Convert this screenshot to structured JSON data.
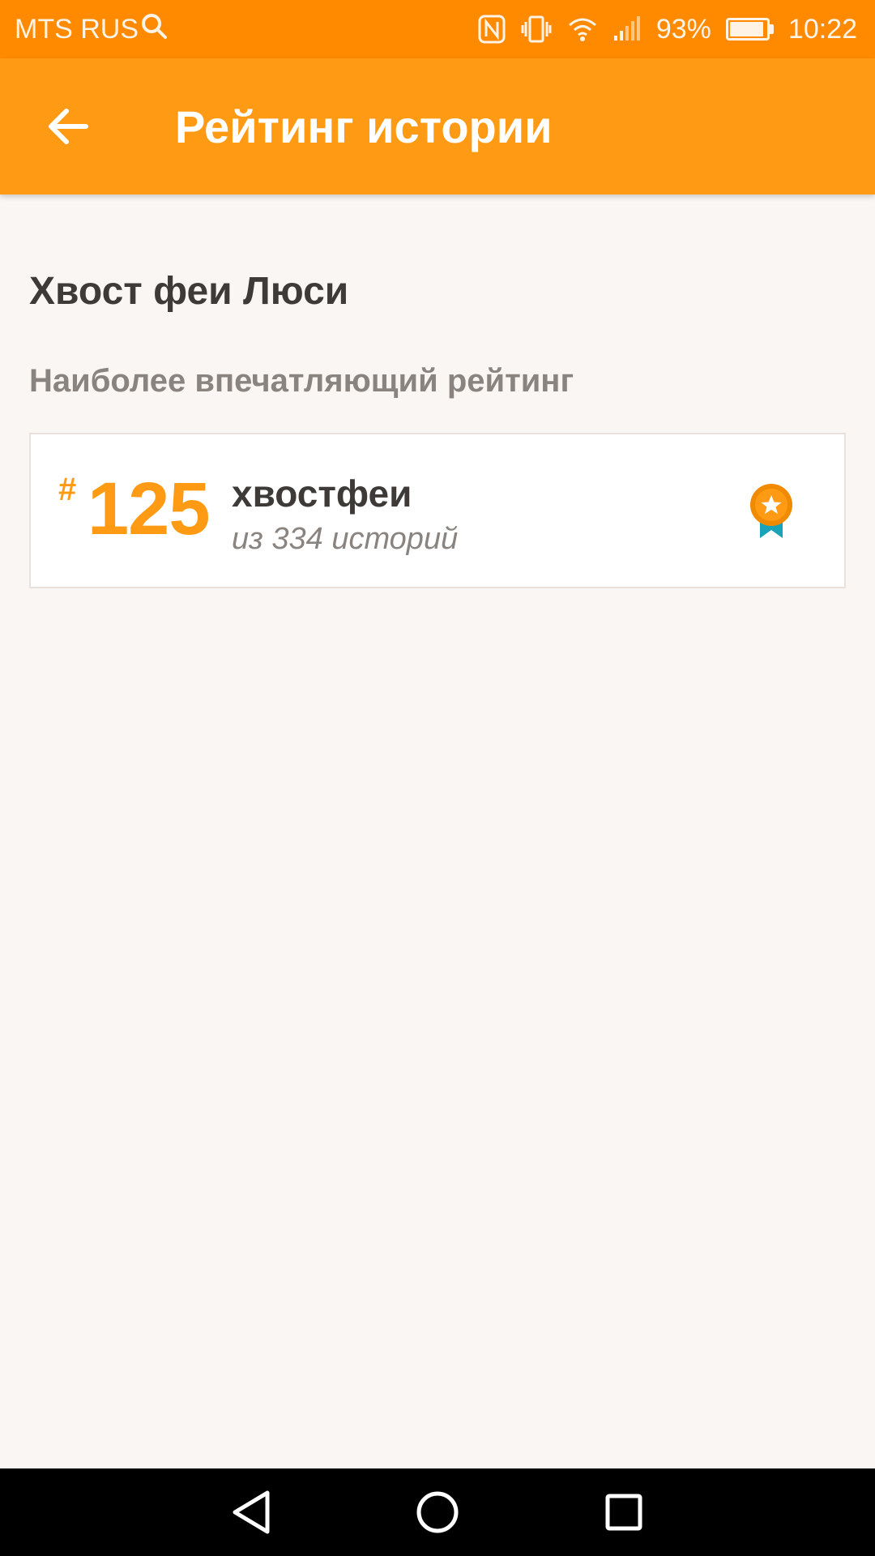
{
  "status_bar": {
    "carrier": "MTS RUS",
    "battery_percent": "93%",
    "battery_level": 0.93,
    "time": "10:22",
    "icons": [
      "search-icon",
      "nfc-icon",
      "vibrate-icon",
      "wifi-icon",
      "signal-icon",
      "battery-icon"
    ]
  },
  "app_bar": {
    "title": "Рейтинг истории",
    "back_icon": "arrow-left-icon"
  },
  "story": {
    "title": "Хвост феи Люси"
  },
  "ranking": {
    "section_label": "Наиболее впечатляющий рейтинг",
    "items": [
      {
        "hash": "#",
        "rank": "125",
        "tag": "хвостфеи",
        "subtitle": "из 334 историй",
        "badge_icon": "award-ribbon-icon"
      }
    ]
  },
  "nav_bar": {
    "icons": [
      "back-triangle-icon",
      "home-circle-icon",
      "recents-square-icon"
    ]
  },
  "colors": {
    "status_bar": "#ff8a00",
    "app_bar": "#ff9a14",
    "accent": "#ff9a14",
    "badge_ribbon": "#1aa3b8",
    "background": "#faf6f3"
  }
}
